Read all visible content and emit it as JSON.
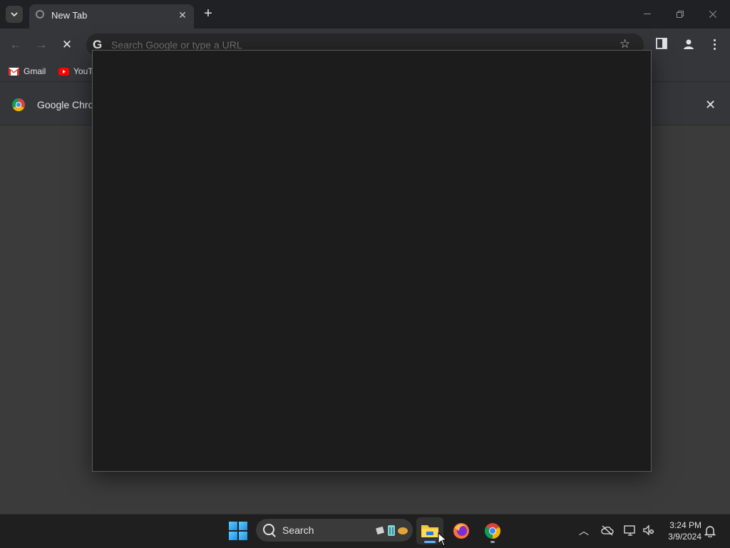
{
  "browser": {
    "tab": {
      "title": "New Tab",
      "close_glyph": "✕"
    },
    "new_tab_glyph": "+",
    "window_controls": {
      "minimize": "—",
      "restore": "❐",
      "close": "✕"
    },
    "omnibox": {
      "value": "",
      "placeholder": "Search Google or type a URL",
      "search_engine_glyph": "G"
    },
    "bookmarks": [
      {
        "label": "Gmail",
        "icon": "gmail-icon"
      },
      {
        "label": "YouT",
        "icon": "youtube-icon"
      }
    ],
    "infobar": {
      "text": "Google Chron",
      "close_glyph": "✕"
    },
    "nav": {
      "back": "←",
      "forward": "→",
      "stop": "✕"
    }
  },
  "taskbar": {
    "search_label": "Search",
    "apps": [
      {
        "name": "File Explorer",
        "icon": "folder-icon",
        "active": true
      },
      {
        "name": "Firefox",
        "icon": "firefox-icon",
        "active": false
      },
      {
        "name": "Google Chrome",
        "icon": "chrome-icon",
        "active": false,
        "running": true
      }
    ],
    "tray_chevron": "^",
    "clock": {
      "time": "3:24 PM",
      "date": "3/9/2024"
    }
  },
  "colors": {
    "tabstrip": "#202124",
    "toolbar": "#35363a",
    "popup": "#1c1c1c",
    "taskbar": "#1f1f1f"
  }
}
